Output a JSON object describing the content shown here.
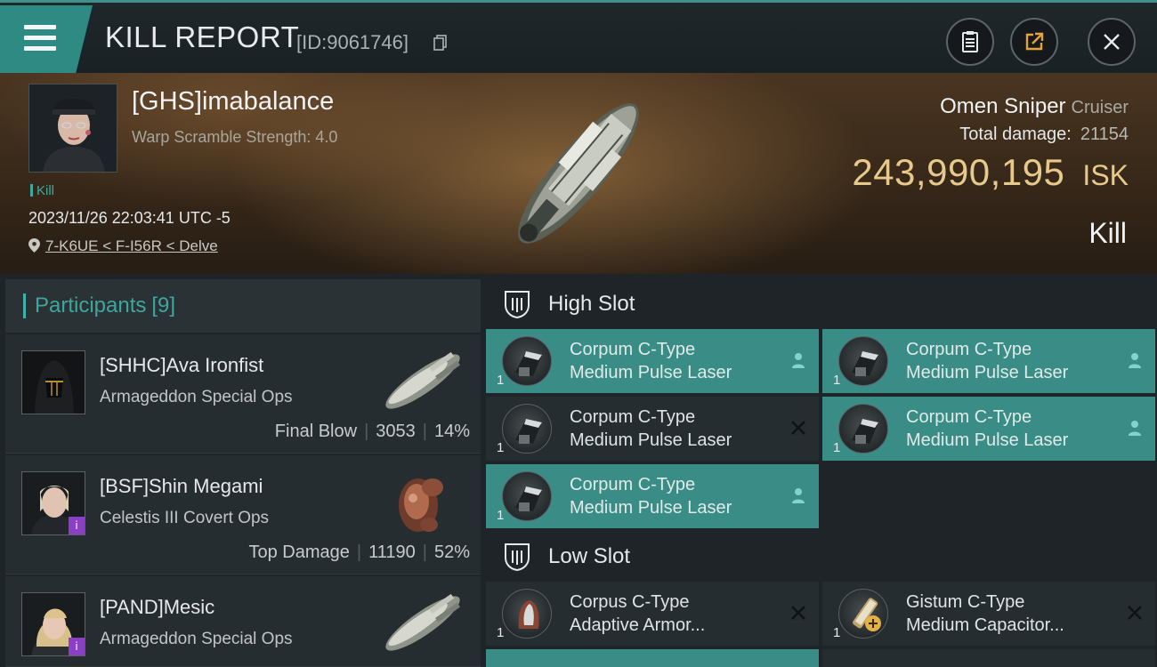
{
  "header": {
    "title": "KILL REPORT",
    "id_text": "[ID:9061746]"
  },
  "victim": {
    "name": "[GHS]imabalance",
    "warp_scramble": "Warp Scramble Strength: 4.0",
    "tag": "Kill",
    "timestamp": "2023/11/26 22:03:41 UTC -5",
    "location": "7-K6UE < F-I56R < Delve",
    "ship_name": "Omen Sniper",
    "ship_class": "Cruiser",
    "total_damage_label": "Total damage:",
    "total_damage": "21154",
    "isk_value": "243,990,195",
    "isk_unit": "ISK",
    "result": "Kill"
  },
  "participants": {
    "title": "Participants",
    "count": "[9]",
    "items": [
      {
        "name": "[SHHC]Ava Ironfist",
        "ship": "Armageddon Special Ops",
        "role": "Final Blow",
        "damage": "3053",
        "percent": "14%",
        "badge": false
      },
      {
        "name": "[BSF]Shin Megami",
        "ship": "Celestis III Covert Ops",
        "role": "Top Damage",
        "damage": "11190",
        "percent": "52%",
        "badge": true
      },
      {
        "name": "[PAND]Mesic",
        "ship": "Armageddon Special Ops",
        "role": "",
        "damage": "",
        "percent": "",
        "badge": true
      }
    ]
  },
  "slots": {
    "high": {
      "label": "High Slot",
      "modules": [
        {
          "line1": "Corpum C-Type",
          "line2": "Medium Pulse Laser",
          "qty": "1",
          "state": "dropped"
        },
        {
          "line1": "Corpum C-Type",
          "line2": "Medium Pulse Laser",
          "qty": "1",
          "state": "dropped"
        },
        {
          "line1": "Corpum C-Type",
          "line2": "Medium Pulse Laser",
          "qty": "1",
          "state": "destroyed"
        },
        {
          "line1": "Corpum C-Type",
          "line2": "Medium Pulse Laser",
          "qty": "1",
          "state": "dropped"
        },
        {
          "line1": "Corpum C-Type",
          "line2": "Medium Pulse Laser",
          "qty": "1",
          "state": "dropped"
        }
      ]
    },
    "low": {
      "label": "Low Slot",
      "modules": [
        {
          "line1": "Corpus C-Type",
          "line2": "Adaptive Armor...",
          "qty": "1",
          "state": "destroyed"
        },
        {
          "line1": "Gistum C-Type",
          "line2": "Medium Capacitor...",
          "qty": "1",
          "state": "destroyed"
        }
      ]
    }
  },
  "colors": {
    "accent": "#3fa69e",
    "isk": "#e8c98c",
    "dropped_bg": "#3a8d86",
    "destroyed_bg": "#262d31"
  }
}
